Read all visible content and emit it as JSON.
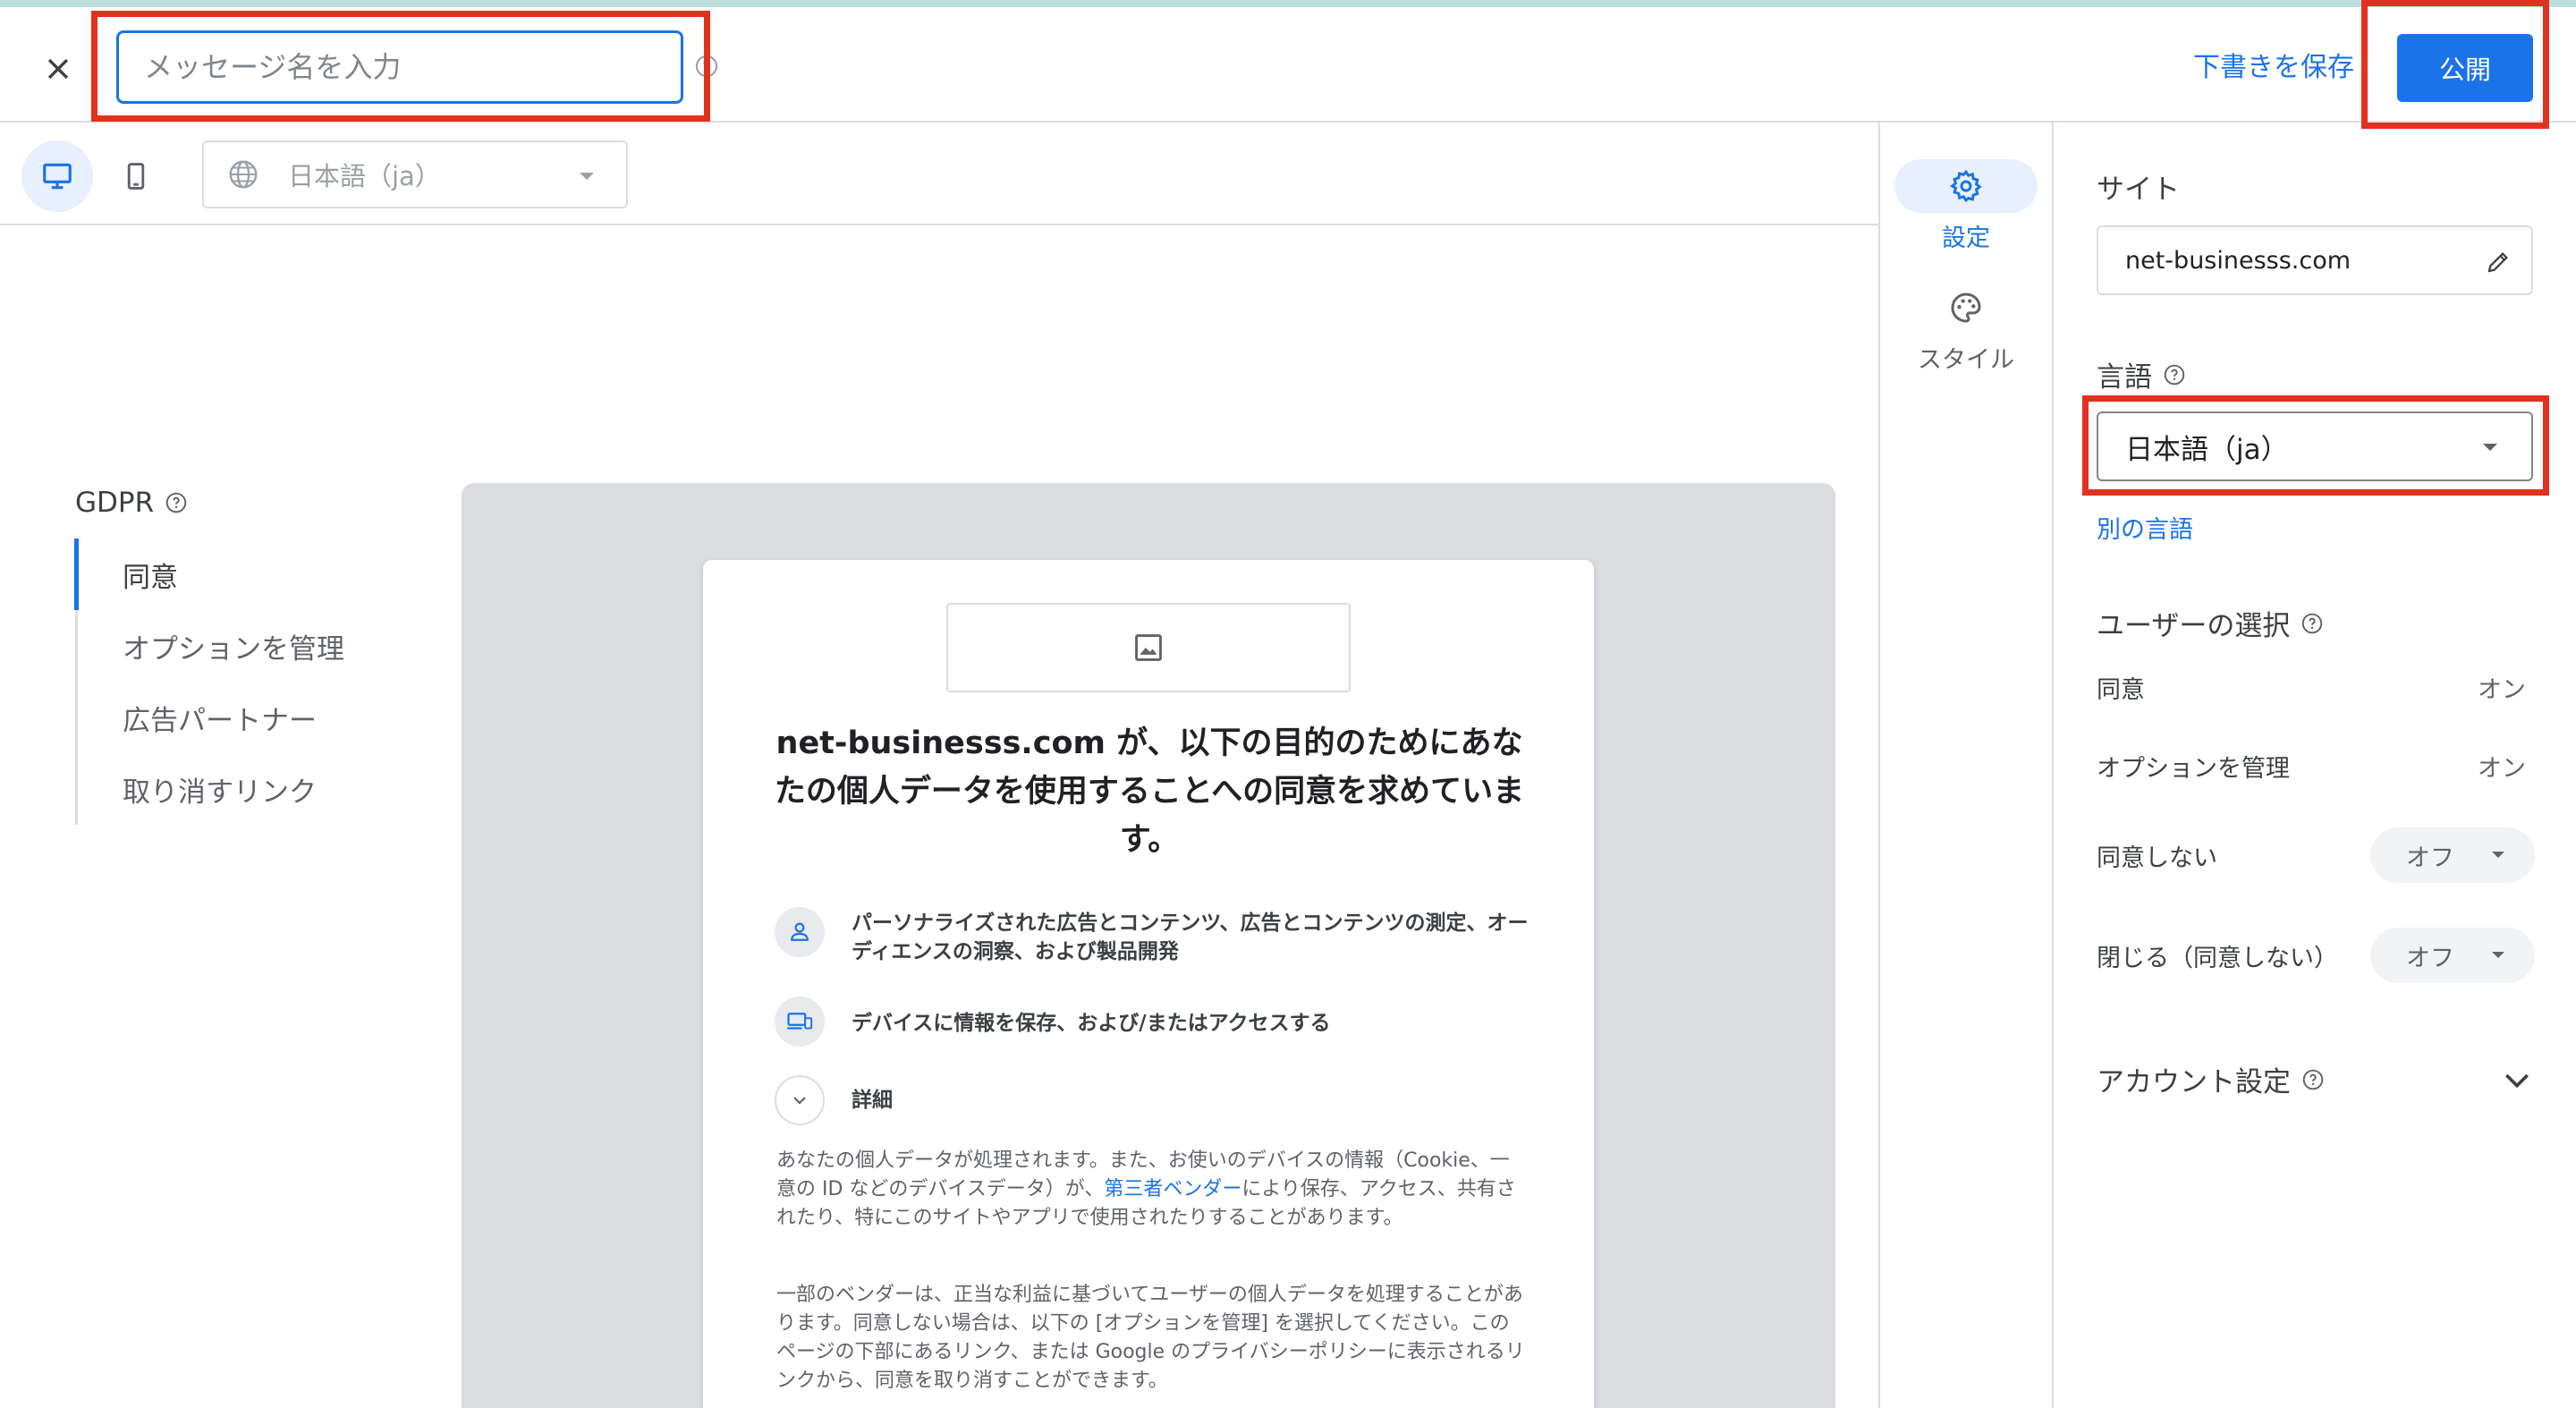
{
  "header": {
    "name_placeholder": "メッセージ名を入力",
    "save_draft_label": "下書きを保存",
    "publish_label": "公開"
  },
  "toolbar": {
    "language_value": "日本語（ja）"
  },
  "gdpr": {
    "title": "GDPR",
    "nav": [
      {
        "label": "同意"
      },
      {
        "label": "オプションを管理"
      },
      {
        "label": "広告パートナー"
      },
      {
        "label": "取り消すリンク"
      }
    ]
  },
  "preview": {
    "title": "net-businesss.com が、以下の目的のためにあなたの個人データを使用することへの同意を求めています。",
    "purposes": [
      {
        "text": "パーソナライズされた広告とコンテンツ、広告とコンテンツの測定、オーディエンスの洞察、および製品開発"
      },
      {
        "text": "デバイスに情報を保存、および/またはアクセスする"
      },
      {
        "text": "詳細"
      }
    ],
    "para1_before": "あなたの個人データが処理されます。また、お使いのデバイスの情報（Cookie、一意の ID などのデバイスデータ）が、",
    "para1_link": "第三者ベンダー",
    "para1_after": "により保存、アクセス、共有されたり、特にこのサイトやアプリで使用されたりすることがあります。",
    "para2": "一部のベンダーは、正当な利益に基づいてユーザーの個人データを処理することがあります。同意しない場合は、以下の [オプションを管理] を選択してください。このページの下部にあるリンク、または Google のプライバシーポリシーに表示されるリンクから、同意を取り消すことができます。"
  },
  "rail": {
    "settings_label": "設定",
    "style_label": "スタイル"
  },
  "panel": {
    "site_label": "サイト",
    "site_value": "net-businesss.com",
    "language_label": "言語",
    "language_value": "日本語（ja）",
    "other_language_link": "別の言語",
    "user_choice_label": "ユーザーの選択",
    "choices": [
      {
        "label": "同意",
        "value": "オン"
      },
      {
        "label": "オプションを管理",
        "value": "オン"
      },
      {
        "label": "同意しない",
        "value": "オフ"
      },
      {
        "label": "閉じる（同意しない）",
        "value": "オフ"
      }
    ],
    "account_settings_label": "アカウント設定"
  },
  "colors": {
    "accent": "#1a73e8",
    "highlight_box": "#e2321f",
    "preview_bg": "#dadce0"
  }
}
